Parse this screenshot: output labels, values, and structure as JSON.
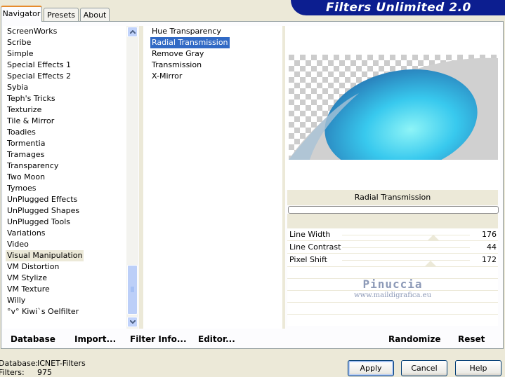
{
  "window": {
    "title": "Filters Unlimited 2.0"
  },
  "tabs": [
    {
      "label": "Navigator",
      "active": true
    },
    {
      "label": "Presets",
      "active": false
    },
    {
      "label": "About",
      "active": false
    }
  ],
  "categories": {
    "items": [
      "ScreenWorks",
      "Scribe",
      "Simple",
      "Special Effects 1",
      "Special Effects 2",
      "Sybia",
      "Teph's Tricks",
      "Texturize",
      "Tile & Mirror",
      "Toadies",
      "Tormentia",
      "Tramages",
      "Transparency",
      "Two Moon",
      "Tymoes",
      "UnPlugged Effects",
      "UnPlugged Shapes",
      "UnPlugged Tools",
      "Variations",
      "Video",
      "Visual Manipulation",
      "VM Distortion",
      "VM Stylize",
      "VM Texture",
      "Willy",
      "°v° Kiwi`s Oelfilter"
    ],
    "selected": "Visual Manipulation"
  },
  "filters": {
    "items": [
      "Hue Transparency",
      "Radial Transmission",
      "Remove Gray",
      "Transmission",
      "X-Mirror"
    ],
    "selected": "Radial Transmission"
  },
  "preview": {
    "filter_name": "Radial Transmission"
  },
  "parameters": [
    {
      "label": "Line Width",
      "value": "176"
    },
    {
      "label": "Line Contrast",
      "value": "44"
    },
    {
      "label": "Pixel Shift",
      "value": "172"
    }
  ],
  "watermark": {
    "name": "Pinuccia",
    "site": "www.maildigrafica.eu"
  },
  "toolbar": {
    "database_label": "Database",
    "import_label": "Import...",
    "filter_info_label": "Filter Info...",
    "editor_label": "Editor...",
    "randomize_label": "Randomize",
    "reset_label": "Reset"
  },
  "status": {
    "database_label": "Database:",
    "database_value": "ICNET-Filters",
    "filters_label": "Filters:",
    "filters_value": "975"
  },
  "dialog_buttons": {
    "apply_label": "Apply",
    "cancel_label": "Cancel",
    "help_label": "Help"
  },
  "colors": {
    "banner": "#0c1e90",
    "selection": "#316ac5",
    "window_bg": "#ece9d8"
  }
}
